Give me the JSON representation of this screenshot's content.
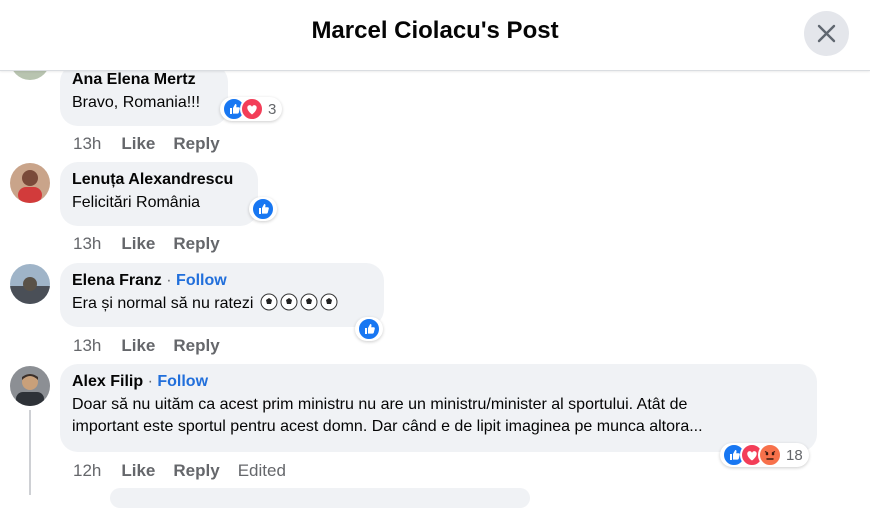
{
  "header": {
    "title": "Marcel Ciolacu's Post"
  },
  "comments": [
    {
      "author": "Ana Elena Mertz",
      "text": "Bravo, Romania!!!",
      "time": "13h",
      "like": "Like",
      "reply": "Reply",
      "reaction_count": "3"
    },
    {
      "author": "Lenuța Alexandrescu",
      "text": "Felicitări România",
      "time": "13h",
      "like": "Like",
      "reply": "Reply"
    },
    {
      "author": "Elena Franz",
      "separator": "·",
      "follow": "Follow",
      "text": "Era și normal să nu ratezi",
      "time": "13h",
      "like": "Like",
      "reply": "Reply"
    },
    {
      "author": "Alex Filip",
      "separator": "·",
      "follow": "Follow",
      "text_line1": "Doar să nu uităm ca acest prim ministru nu are un ministru/minister al sportului. Atât de",
      "text_line2": "important este sportul pentru acest domn. Dar când e de lipit imaginea pe munca altora...",
      "time": "12h",
      "like": "Like",
      "reply": "Reply",
      "edited": "Edited",
      "reaction_count": "18"
    }
  ],
  "icons": [
    "close-icon",
    "like-reaction-icon",
    "love-reaction-icon",
    "angry-reaction-icon",
    "soccer-ball-icon"
  ],
  "colors": {
    "link": "#216fdb",
    "bubble": "#f0f2f5",
    "like": "#1877f2",
    "love": "#f33e58",
    "angry": "#f7714b",
    "meta": "#65676b"
  }
}
